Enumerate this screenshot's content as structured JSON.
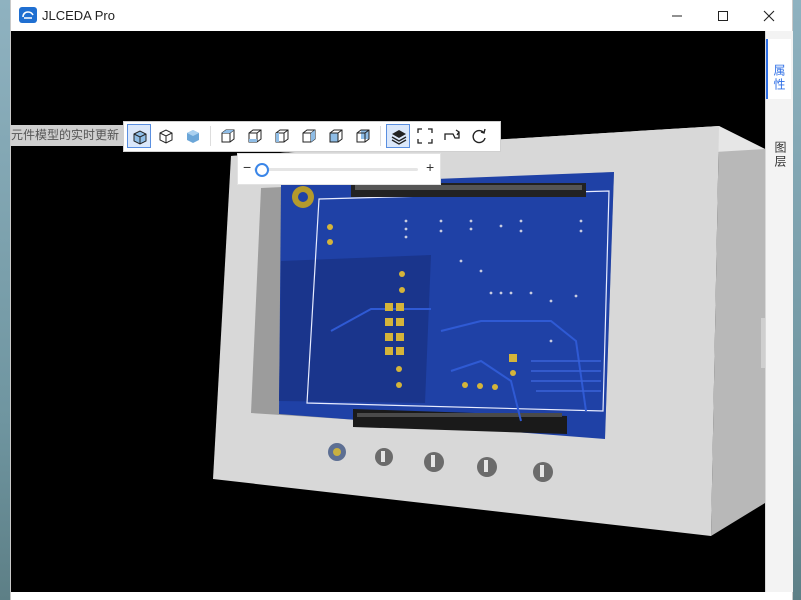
{
  "window": {
    "title": "JLCEDA Pro"
  },
  "viewer": {
    "hint_label": "元件模型的实时更新",
    "zoom_level": 0.05,
    "zoom_minus": "−",
    "zoom_plus": "+"
  },
  "toolbar": {
    "groups": [
      [
        "solid-view",
        "edges-view",
        "shaded-view"
      ],
      [
        "view-top",
        "view-bottom",
        "view-left",
        "view-right",
        "view-front",
        "view-back"
      ],
      [
        "layers",
        "fullscreen",
        "rotate-step",
        "reset-rotation"
      ]
    ]
  },
  "right_panel": {
    "tabs": [
      {
        "label": "属性",
        "active": true
      },
      {
        "label": "图层",
        "active": false
      }
    ]
  },
  "colors": {
    "accent": "#2f6fe6",
    "pcb": "#1e3fa0",
    "enclosure": "#d9d9d9"
  }
}
